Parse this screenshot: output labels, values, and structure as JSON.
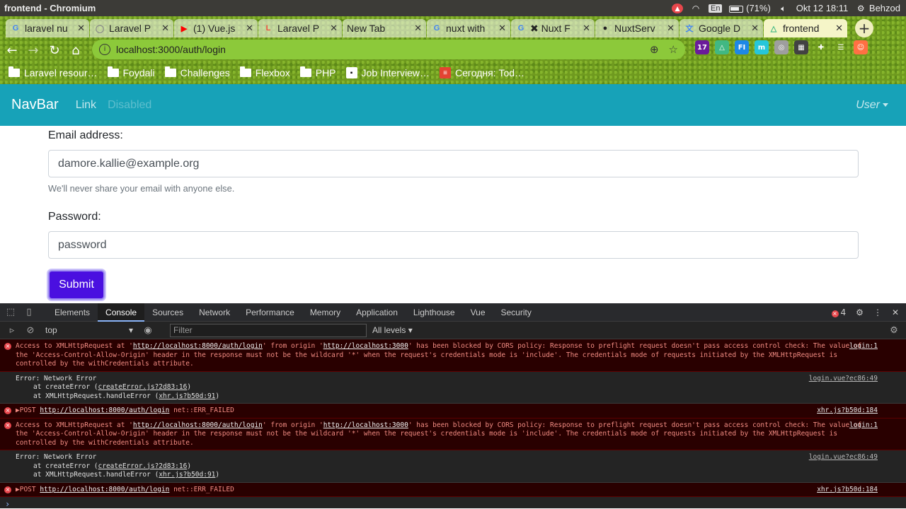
{
  "os": {
    "title": "frontend - Chromium",
    "battery": "(71%)",
    "lang": "En",
    "datetime": "Okt 12 18:11",
    "user": "Behzod"
  },
  "tabs": [
    {
      "label": "laravel nu",
      "icon": "google-icon",
      "color": "#4285f4",
      "glyph": "G"
    },
    {
      "label": "Laravel P",
      "icon": "laravel-icon",
      "color": "#888888",
      "glyph": "◯"
    },
    {
      "label": "(1) Vue.js",
      "icon": "youtube-icon",
      "color": "#ff0000",
      "glyph": "▶"
    },
    {
      "label": "Laravel P",
      "icon": "laravel-icon",
      "color": "#f05340",
      "glyph": "L"
    },
    {
      "label": "New Tab",
      "icon": "",
      "color": "",
      "glyph": ""
    },
    {
      "label": "nuxt with",
      "icon": "google-icon",
      "color": "#4285f4",
      "glyph": "G"
    },
    {
      "label": "✖ Nuxt F",
      "icon": "google-icon",
      "color": "#4285f4",
      "glyph": "G"
    },
    {
      "label": "NuxtServ",
      "icon": "github-icon",
      "color": "#222222",
      "glyph": "●"
    },
    {
      "label": "Google D",
      "icon": "google-translate-icon",
      "color": "#4285f4",
      "glyph": "文"
    },
    {
      "label": "frontend",
      "icon": "nuxt-icon",
      "color": "#41b883",
      "glyph": "△",
      "active": true
    }
  ],
  "omnibox": {
    "url": "localhost:3000/auth/login"
  },
  "extensions": [
    {
      "icon": "calendar-ext-icon",
      "color": "#6a1b9a",
      "glyph": "17"
    },
    {
      "icon": "nuxt-ext-icon",
      "color": "#41b883",
      "glyph": "△"
    },
    {
      "icon": "fi-ext-icon",
      "color": "#1e88e5",
      "glyph": "FI"
    },
    {
      "icon": "m-ext-icon",
      "color": "#26c6da",
      "glyph": "m"
    },
    {
      "icon": "circle-ext-icon",
      "color": "#9e9e9e",
      "glyph": "◎"
    },
    {
      "icon": "qr-ext-icon",
      "color": "#424242",
      "glyph": "▦"
    },
    {
      "icon": "puzzle-icon",
      "color": "transparent",
      "glyph": "✚"
    },
    {
      "icon": "reading-list-icon",
      "color": "transparent",
      "glyph": "☰"
    },
    {
      "icon": "profile-avatar-icon",
      "color": "#ff7043",
      "glyph": "☺"
    }
  ],
  "bookmarks": [
    {
      "label": "Laravel resour…",
      "type": "folder"
    },
    {
      "label": "Foydali",
      "type": "folder"
    },
    {
      "label": "Challenges",
      "type": "folder"
    },
    {
      "label": "Flexbox",
      "type": "folder"
    },
    {
      "label": "PHP",
      "type": "folder"
    },
    {
      "label": "Job Interview…",
      "type": "page",
      "color": "#ffffff",
      "glyph": "▪"
    },
    {
      "label": "Сегодня: Tod…",
      "type": "page",
      "color": "#e44332",
      "glyph": "≡"
    }
  ],
  "navbar": {
    "brand": "NavBar",
    "link": "Link",
    "disabled": "Disabled",
    "user": "User"
  },
  "form": {
    "email_label": "Email address:",
    "email_value": "damore.kallie@example.org",
    "email_help": "We'll never share your email with anyone else.",
    "password_label": "Password:",
    "password_value": "password",
    "submit_label": "Submit"
  },
  "devtools": {
    "tabs": [
      "Elements",
      "Console",
      "Sources",
      "Network",
      "Performance",
      "Memory",
      "Application",
      "Lighthouse",
      "Vue",
      "Security"
    ],
    "active_tab": "Console",
    "error_count": "4",
    "context": "top",
    "filter_placeholder": "Filter",
    "levels": "All levels",
    "messages": [
      {
        "type": "error",
        "pre": "Access to XMLHttpRequest at '",
        "link1": "http://localhost:8000/auth/login",
        "mid": "' from origin '",
        "link2": "http://localhost:3000",
        "post": "' has been blocked by CORS policy: Response to preflight request doesn't pass access control check: The value of the 'Access-Control-Allow-Origin' header in the response must not be the wildcard '*' when the request's credentials mode is 'include'. The credentials mode of requests initiated by the XMLHttpRequest is controlled by the withCredentials attribute.",
        "source": "login:1"
      },
      {
        "type": "plain",
        "line1": "Error: Network Error",
        "line2_pre": "at createError (",
        "line2_link": "createError.js?2d83:16",
        "line2_post": ")",
        "line3_pre": "at XMLHttpRequest.handleError (",
        "line3_link": "xhr.js?b50d:91",
        "line3_post": ")",
        "source": "login.vue?ec86:49"
      },
      {
        "type": "error-post",
        "method": "▶POST ",
        "link": "http://localhost:8000/auth/login",
        "post": " net::ERR_FAILED",
        "source": "xhr.js?b50d:184"
      }
    ]
  }
}
